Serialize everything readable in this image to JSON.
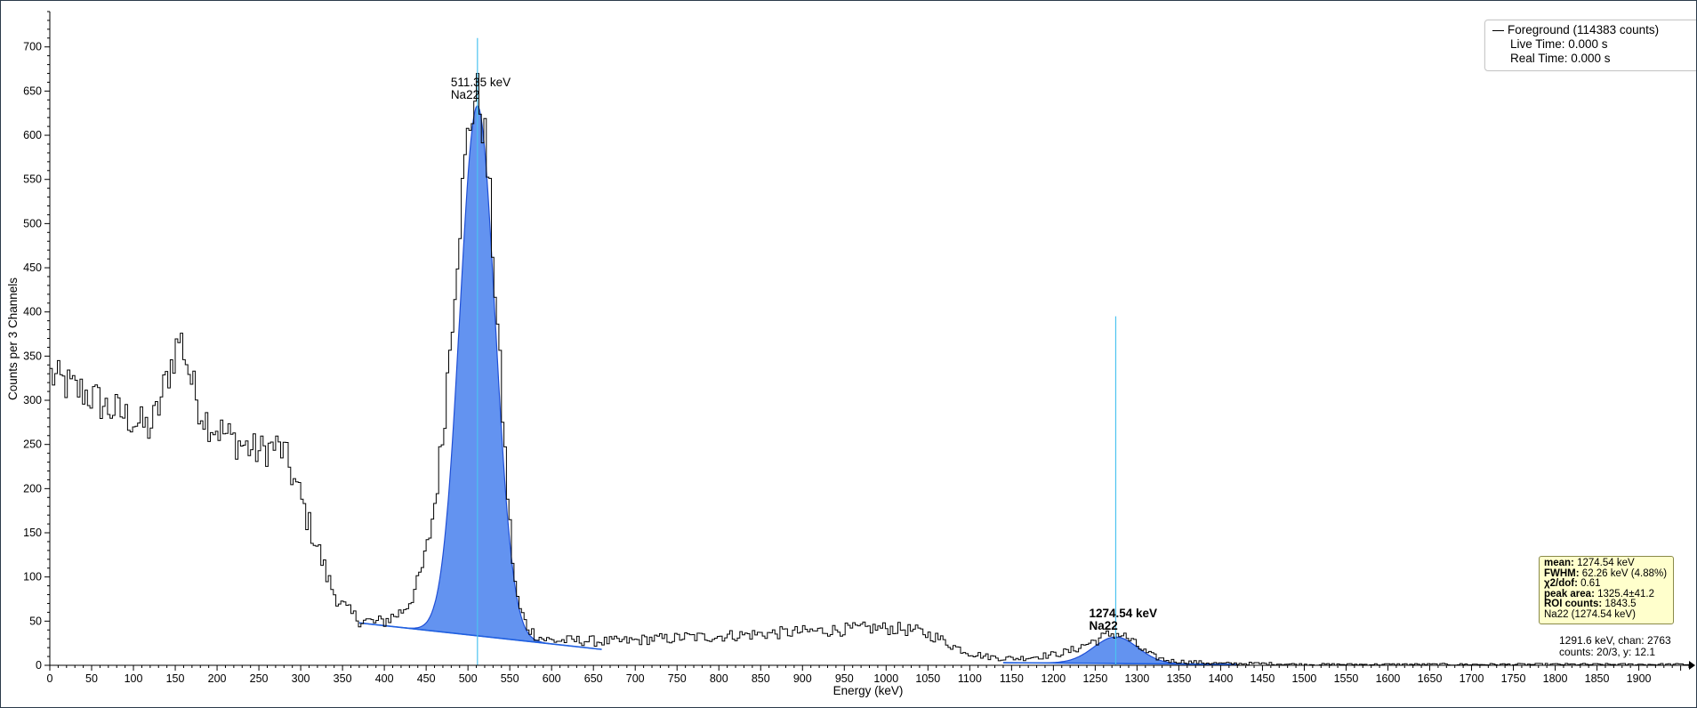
{
  "chart_data": {
    "type": "line",
    "xlabel": "Energy (keV)",
    "ylabel": "Counts per 3 Channels",
    "xlim": [
      0,
      1960
    ],
    "ylim": [
      0,
      740
    ],
    "x_ticks": [
      0,
      50,
      100,
      150,
      200,
      250,
      300,
      350,
      400,
      450,
      500,
      550,
      600,
      650,
      700,
      750,
      800,
      850,
      900,
      950,
      1000,
      1050,
      1100,
      1150,
      1200,
      1250,
      1300,
      1350,
      1400,
      1450,
      1500,
      1550,
      1600,
      1650,
      1700,
      1750,
      1800,
      1850,
      1900
    ],
    "y_ticks": [
      0,
      50,
      100,
      150,
      200,
      250,
      300,
      350,
      400,
      450,
      500,
      550,
      600,
      650,
      700
    ],
    "spectrum": [
      [
        0,
        330
      ],
      [
        10,
        322
      ],
      [
        20,
        318
      ],
      [
        30,
        312
      ],
      [
        40,
        310
      ],
      [
        50,
        304
      ],
      [
        60,
        298
      ],
      [
        70,
        290
      ],
      [
        80,
        288
      ],
      [
        90,
        282
      ],
      [
        100,
        278
      ],
      [
        110,
        272
      ],
      [
        120,
        268
      ],
      [
        130,
        290
      ],
      [
        140,
        325
      ],
      [
        150,
        355
      ],
      [
        155,
        372
      ],
      [
        160,
        360
      ],
      [
        170,
        320
      ],
      [
        180,
        290
      ],
      [
        190,
        275
      ],
      [
        200,
        268
      ],
      [
        210,
        262
      ],
      [
        220,
        255
      ],
      [
        230,
        250
      ],
      [
        240,
        245
      ],
      [
        250,
        242
      ],
      [
        260,
        245
      ],
      [
        270,
        248
      ],
      [
        280,
        242
      ],
      [
        290,
        215
      ],
      [
        300,
        190
      ],
      [
        310,
        160
      ],
      [
        320,
        135
      ],
      [
        330,
        105
      ],
      [
        340,
        82
      ],
      [
        350,
        68
      ],
      [
        360,
        58
      ],
      [
        370,
        52
      ],
      [
        380,
        50
      ],
      [
        390,
        48
      ],
      [
        400,
        50
      ],
      [
        410,
        55
      ],
      [
        420,
        60
      ],
      [
        430,
        72
      ],
      [
        440,
        92
      ],
      [
        450,
        125
      ],
      [
        460,
        180
      ],
      [
        470,
        260
      ],
      [
        480,
        380
      ],
      [
        490,
        500
      ],
      [
        500,
        600
      ],
      [
        505,
        630
      ],
      [
        510,
        645
      ],
      [
        515,
        635
      ],
      [
        520,
        600
      ],
      [
        525,
        545
      ],
      [
        530,
        470
      ],
      [
        535,
        390
      ],
      [
        540,
        310
      ],
      [
        545,
        230
      ],
      [
        550,
        160
      ],
      [
        555,
        105
      ],
      [
        560,
        70
      ],
      [
        570,
        45
      ],
      [
        580,
        35
      ],
      [
        590,
        30
      ],
      [
        600,
        28
      ],
      [
        620,
        28
      ],
      [
        640,
        28
      ],
      [
        660,
        27
      ],
      [
        680,
        27
      ],
      [
        700,
        28
      ],
      [
        720,
        30
      ],
      [
        740,
        30
      ],
      [
        760,
        32
      ],
      [
        780,
        32
      ],
      [
        800,
        33
      ],
      [
        820,
        34
      ],
      [
        840,
        35
      ],
      [
        860,
        36
      ],
      [
        880,
        37
      ],
      [
        900,
        38
      ],
      [
        920,
        39
      ],
      [
        940,
        40
      ],
      [
        960,
        41
      ],
      [
        980,
        42
      ],
      [
        1000,
        42
      ],
      [
        1020,
        41
      ],
      [
        1040,
        38
      ],
      [
        1060,
        32
      ],
      [
        1080,
        22
      ],
      [
        1100,
        14
      ],
      [
        1120,
        10
      ],
      [
        1140,
        8
      ],
      [
        1160,
        8
      ],
      [
        1180,
        10
      ],
      [
        1200,
        12
      ],
      [
        1220,
        16
      ],
      [
        1240,
        24
      ],
      [
        1260,
        32
      ],
      [
        1270,
        36
      ],
      [
        1280,
        35
      ],
      [
        1290,
        30
      ],
      [
        1300,
        22
      ],
      [
        1310,
        15
      ],
      [
        1320,
        10
      ],
      [
        1330,
        7
      ],
      [
        1340,
        5
      ],
      [
        1360,
        4
      ],
      [
        1380,
        3
      ],
      [
        1400,
        2
      ],
      [
        1450,
        2
      ],
      [
        1500,
        1
      ],
      [
        1550,
        1
      ],
      [
        1600,
        1
      ],
      [
        1700,
        1
      ],
      [
        1800,
        1
      ],
      [
        1900,
        1
      ],
      [
        1960,
        1
      ]
    ],
    "peaks": [
      {
        "energy_label": "511.35 keV",
        "nuclide": "Na22",
        "mean": 511.35,
        "sigma": 21,
        "amplitude": 600,
        "roi": [
          370,
          660
        ],
        "continuum": [
          48,
          18
        ],
        "marker_top": 710
      },
      {
        "energy_label": "1274.54 keV",
        "nuclide": "Na22",
        "mean": 1274.54,
        "sigma": 26.4,
        "amplitude": 30,
        "roi": [
          1140,
          1420
        ],
        "continuum": [
          3,
          1
        ],
        "marker_top": 395
      }
    ],
    "cursor_text": [
      "1291.6 keV, chan: 2763",
      "counts: 20/3, y: 12.1"
    ]
  },
  "legend": {
    "series_label": "Foreground (114383 counts)",
    "live_time": "Live Time: 0.000 s",
    "real_time": "Real Time: 0.000 s"
  },
  "infobox": {
    "mean_label": "mean:",
    "mean_value": "1274.54 keV",
    "fwhm_label": "FWHM:",
    "fwhm_value": "62.26 keV (4.88%)",
    "chi_label": "χ2/dof:",
    "chi_value": "0.61",
    "area_label": "peak area:",
    "area_value": "1325.4±41.2",
    "roi_label": "ROI counts:",
    "roi_value": "1843.5",
    "nuclide_line": "Na22 (1274.54 keV)"
  },
  "colors": {
    "spectrum": "#000000",
    "peak_fill": "#5b8def",
    "peak_stroke": "#1f4fd6",
    "continuum": "#2060e0",
    "marker": "#4cc3f0",
    "axis": "#000000"
  }
}
